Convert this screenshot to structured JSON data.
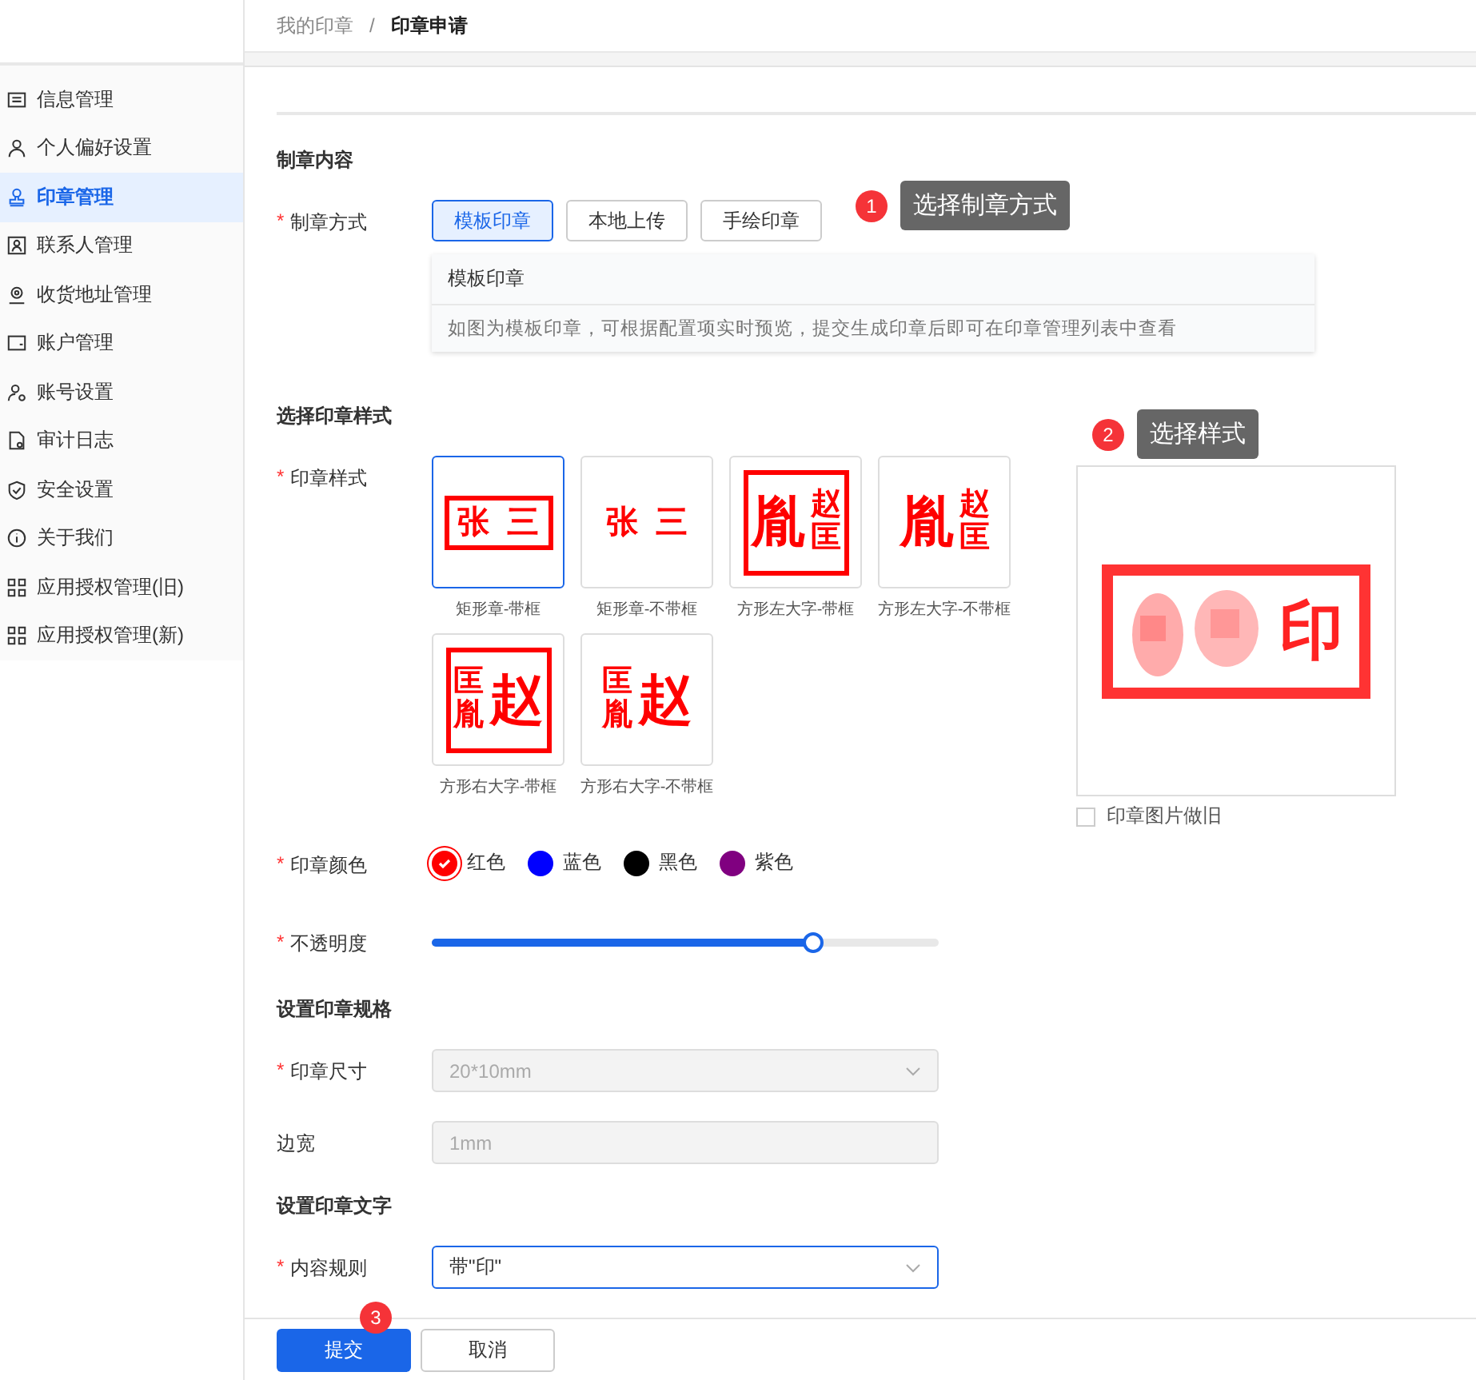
{
  "breadcrumb": {
    "separator": "/",
    "items": [
      {
        "label": "我的印章",
        "current": false
      },
      {
        "label": "印章申请",
        "current": true
      }
    ]
  },
  "sidebar": {
    "items": [
      {
        "label": "信息管理",
        "selected": false
      },
      {
        "label": "个人偏好设置",
        "selected": false
      },
      {
        "label": "印章管理",
        "selected": true
      },
      {
        "label": "联系人管理",
        "selected": false
      },
      {
        "label": "收货地址管理",
        "selected": false
      },
      {
        "label": "账户管理",
        "selected": false
      },
      {
        "label": "账号设置",
        "selected": false
      },
      {
        "label": "审计日志",
        "selected": false
      },
      {
        "label": "安全设置",
        "selected": false
      },
      {
        "label": "关于我们",
        "selected": false
      },
      {
        "label": "应用授权管理(旧)",
        "selected": false
      },
      {
        "label": "应用授权管理(新)",
        "selected": false
      }
    ]
  },
  "content_section": {
    "title": "制章内容",
    "required_mark": "*",
    "field_label": "制章方式",
    "options": [
      {
        "label": "模板印章",
        "selected": true
      },
      {
        "label": "本地上传",
        "selected": false
      },
      {
        "label": "手绘印章",
        "selected": false
      }
    ],
    "info": {
      "title": "模板印章",
      "text": "如图为模板印章，可根据配置项实时预览，提交生成印章后即可在印章管理列表中查看"
    },
    "callout": {
      "number": "1",
      "text": "选择制章方式"
    }
  },
  "style_section": {
    "title": "选择印章样式",
    "required_mark": "*",
    "field_label": "印章样式",
    "styles": [
      {
        "kind": "rect",
        "framed": true,
        "small": [
          "张",
          "三"
        ],
        "caption": "矩形章-带框",
        "selected": true
      },
      {
        "kind": "rect",
        "framed": false,
        "small": [
          "张",
          "三"
        ],
        "caption": "矩形章-不带框",
        "selected": false
      },
      {
        "kind": "left",
        "framed": true,
        "big": "胤",
        "small": [
          "赵",
          "匡"
        ],
        "caption": "方形左大字-带框",
        "selected": false
      },
      {
        "kind": "left",
        "framed": false,
        "big": "胤",
        "small": [
          "赵",
          "匡"
        ],
        "caption": "方形左大字-不带框",
        "selected": false
      },
      {
        "kind": "right",
        "framed": true,
        "big": "赵",
        "small": [
          "匡",
          "胤"
        ],
        "caption": "方形右大字-带框",
        "selected": false
      },
      {
        "kind": "right",
        "framed": false,
        "big": "赵",
        "small": [
          "匡",
          "胤"
        ],
        "caption": "方形右大字-不带框",
        "selected": false
      }
    ],
    "callout": {
      "number": "2",
      "text": "选择样式"
    },
    "preview": {
      "char": "印",
      "aged_label": "印章图片做旧",
      "aged": false
    }
  },
  "color_field": {
    "required_mark": "*",
    "label": "印章颜色",
    "options": [
      {
        "label": "红色",
        "color": "#ff0000",
        "selected": true
      },
      {
        "label": "蓝色",
        "color": "#0000ff",
        "selected": false
      },
      {
        "label": "黑色",
        "color": "#000000",
        "selected": false
      },
      {
        "label": "紫色",
        "color": "#800080",
        "selected": false
      }
    ]
  },
  "opacity_field": {
    "required_mark": "*",
    "label": "不透明度",
    "level": 0.75
  },
  "spec_section": {
    "title": "设置印章规格",
    "size": {
      "required_mark": "*",
      "label": "印章尺寸",
      "value": "20*10mm",
      "disabled": true
    },
    "border": {
      "label": "边宽",
      "value": "1mm",
      "disabled": true
    }
  },
  "text_section": {
    "title": "设置印章文字",
    "rule": {
      "required_mark": "*",
      "label": "内容规则",
      "value": "带\"印\""
    }
  },
  "footer": {
    "callout": {
      "number": "3"
    },
    "buttons": [
      {
        "label": "提交",
        "primary": true
      },
      {
        "label": "取消",
        "primary": false
      }
    ]
  }
}
